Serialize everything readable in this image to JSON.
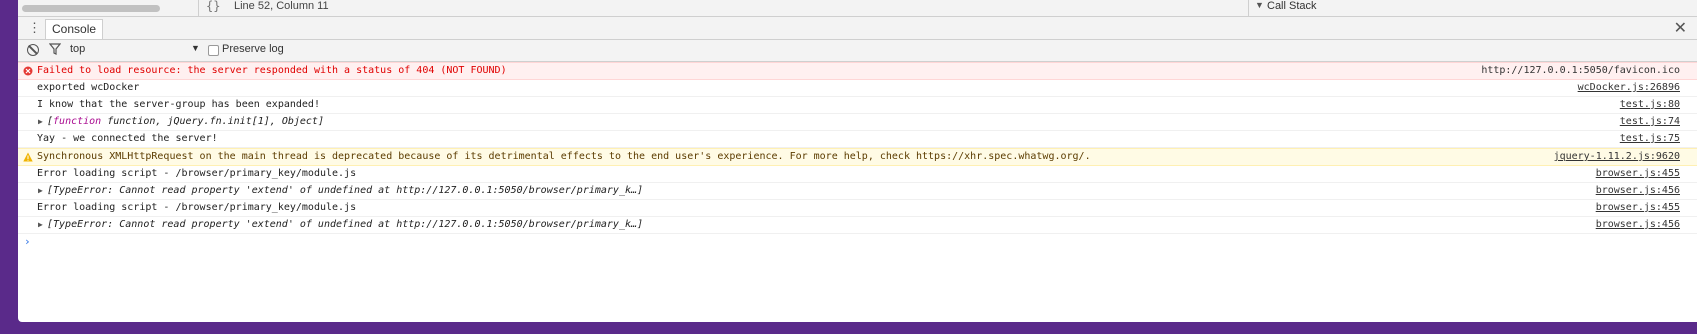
{
  "topbar": {
    "braces": "{}",
    "cursor_position": "Line 52, Column 11",
    "call_stack_label": "Call Stack"
  },
  "drawer": {
    "tab_label": "Console"
  },
  "toolbar": {
    "context": "top",
    "preserve_log_label": "Preserve log",
    "preserve_log_checked": false
  },
  "messages": [
    {
      "level": "error",
      "text": "Failed to load resource: the server responded with a status of 404 (NOT FOUND)",
      "source": "http://127.0.0.1:5050/favicon.ico"
    },
    {
      "level": "log",
      "text": "exported wcDocker",
      "source": "wcDocker.js:26896"
    },
    {
      "level": "log",
      "text": "I know that the server-group has been expanded!",
      "source": "test.js:80"
    },
    {
      "level": "log",
      "object": true,
      "kw": "function",
      "text": " function, jQuery.fn.init[1], Object]",
      "prefix": "[",
      "source": "test.js:74"
    },
    {
      "level": "log",
      "text": "Yay - we connected the server!",
      "source": "test.js:75"
    },
    {
      "level": "warning",
      "text": "Synchronous XMLHttpRequest on the main thread is deprecated because of its detrimental effects to the end user's experience. For more help, check https://xhr.spec.whatwg.org/.",
      "source": "jquery-1.11.2.js:9620"
    },
    {
      "level": "log",
      "text": "Error loading script - /browser/primary_key/module.js",
      "source": "browser.js:455"
    },
    {
      "level": "log",
      "object": true,
      "text": "[TypeError: Cannot read property 'extend' of undefined at http://127.0.0.1:5050/browser/primary_k…]",
      "source": "browser.js:456"
    },
    {
      "level": "log",
      "text": "Error loading script - /browser/primary_key/module.js",
      "source": "browser.js:455"
    },
    {
      "level": "log",
      "object": true,
      "text": "[TypeError: Cannot read property 'extend' of undefined at http://127.0.0.1:5050/browser/primary_k…]",
      "source": "browser.js:456"
    }
  ],
  "prompt": "›",
  "colors": {
    "error_bg": "#fff0f0",
    "error_text": "#e00000",
    "warning_bg": "#fffbe5",
    "prompt": "#2b71e6"
  }
}
